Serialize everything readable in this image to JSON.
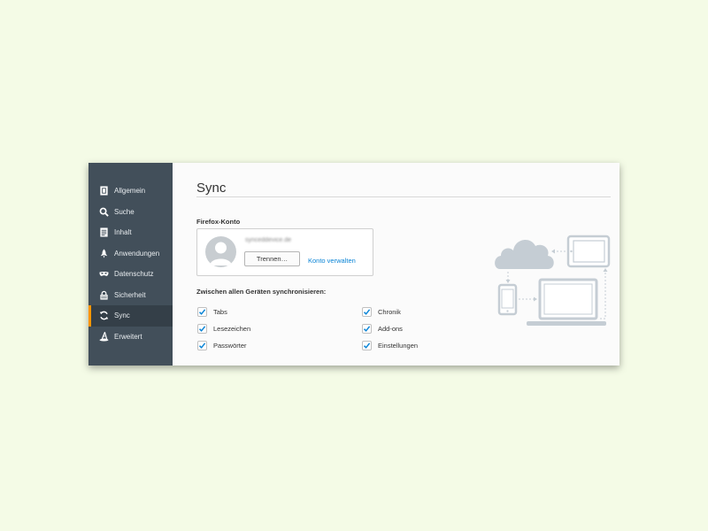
{
  "sidebar": {
    "items": [
      {
        "label": "Allgemein",
        "icon": "general-icon"
      },
      {
        "label": "Suche",
        "icon": "search-icon"
      },
      {
        "label": "Inhalt",
        "icon": "document-icon"
      },
      {
        "label": "Anwendungen",
        "icon": "rocket-icon"
      },
      {
        "label": "Datenschutz",
        "icon": "mask-icon"
      },
      {
        "label": "Sicherheit",
        "icon": "lock-icon"
      },
      {
        "label": "Sync",
        "icon": "sync-icon",
        "active": true
      },
      {
        "label": "Erweitert",
        "icon": "wizard-hat-icon"
      }
    ],
    "accent": "#ff9500"
  },
  "main": {
    "title": "Sync",
    "account": {
      "heading": "Firefox-Konto",
      "email": "synceddevice.de",
      "disconnect_label": "Trennen…",
      "manage_label": "Konto verwalten"
    },
    "sync_heading": "Zwischen allen Geräten synchronisieren:",
    "options": [
      {
        "label": "Tabs",
        "checked": true
      },
      {
        "label": "Lesezeichen",
        "checked": true
      },
      {
        "label": "Passwörter",
        "checked": true
      },
      {
        "label": "Chronik",
        "checked": true
      },
      {
        "label": "Add-ons",
        "checked": true
      },
      {
        "label": "Einstellungen",
        "checked": true
      }
    ]
  },
  "colors": {
    "checkmark": "#0a84d6",
    "link": "#0a84d6",
    "sidebar_bg": "#424f5a"
  }
}
